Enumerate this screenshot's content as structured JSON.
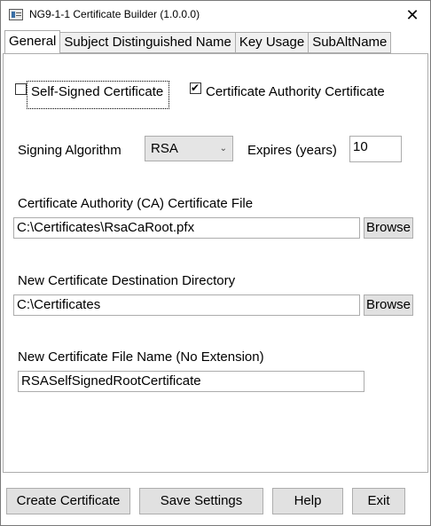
{
  "window": {
    "title": "NG9-1-1 Certificate Builder (1.0.0.0)",
    "close_glyph": "✕"
  },
  "tabs": [
    {
      "label": "General",
      "active": true
    },
    {
      "label": "Subject Distinguished Name",
      "active": false
    },
    {
      "label": "Key Usage",
      "active": false
    },
    {
      "label": "SubAltName",
      "active": false
    }
  ],
  "general": {
    "self_signed_label": "Self-Signed Certificate",
    "self_signed_checked": false,
    "ca_cert_label": "Certificate Authority Certificate",
    "ca_cert_checked": true,
    "signing_algorithm_label": "Signing Algorithm",
    "signing_algorithm_value": "RSA",
    "expires_label": "Expires (years)",
    "expires_value": "10",
    "ca_file_label": "Certificate Authority (CA) Certificate File",
    "ca_file_value": "C:\\Certificates\\RsaCaRoot.pfx",
    "dest_dir_label": "New Certificate Destination Directory",
    "dest_dir_value": "C:\\Certificates",
    "file_name_label": "New Certificate File Name (No Extension)",
    "file_name_value": "RSASelfSignedRootCertificate",
    "browse_label": "Browse"
  },
  "buttons": {
    "create": "Create Certificate",
    "save": "Save Settings",
    "help": "Help",
    "exit": "Exit"
  }
}
